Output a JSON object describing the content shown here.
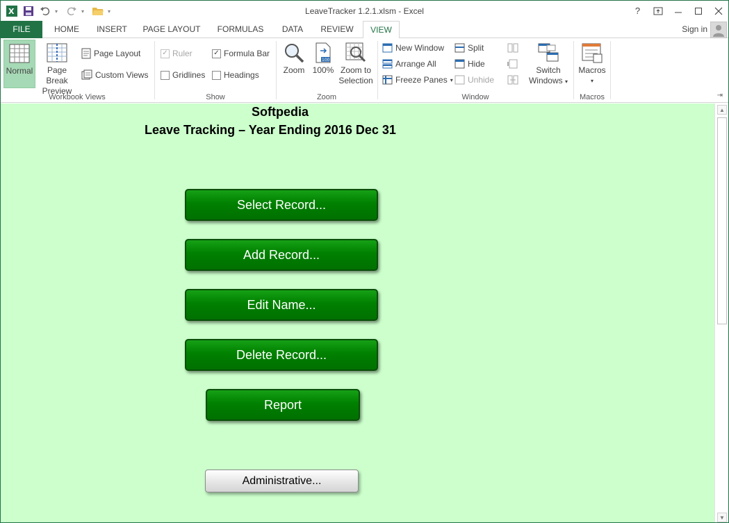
{
  "window": {
    "title": "LeaveTracker 1.2.1.xlsm - Excel",
    "help": "?",
    "controls": [
      "restore-ribbon",
      "minimize",
      "maximize",
      "close"
    ]
  },
  "tabs": [
    {
      "label": "FILE"
    },
    {
      "label": "HOME"
    },
    {
      "label": "INSERT"
    },
    {
      "label": "PAGE LAYOUT"
    },
    {
      "label": "FORMULAS"
    },
    {
      "label": "DATA"
    },
    {
      "label": "REVIEW"
    },
    {
      "label": "VIEW",
      "active": true
    }
  ],
  "account": {
    "signin": "Sign in"
  },
  "ribbon": {
    "workbook_views": {
      "label": "Workbook Views",
      "normal": "Normal",
      "page_break_1": "Page Break",
      "page_break_2": "Preview",
      "page_layout": "Page Layout",
      "custom_views": "Custom Views"
    },
    "show": {
      "label": "Show",
      "ruler": "Ruler",
      "gridlines": "Gridlines",
      "formula_bar": "Formula Bar",
      "headings": "Headings",
      "ruler_checked": true,
      "gridlines_checked": false,
      "formula_bar_checked": true,
      "headings_checked": false
    },
    "zoom": {
      "label": "Zoom",
      "zoom": "Zoom",
      "hundred": "100%",
      "zoom_sel_1": "Zoom to",
      "zoom_sel_2": "Selection"
    },
    "window": {
      "label": "Window",
      "new_window": "New Window",
      "arrange_all": "Arrange All",
      "freeze_panes": "Freeze Panes",
      "split": "Split",
      "hide": "Hide",
      "unhide": "Unhide",
      "switch_1": "Switch",
      "switch_2": "Windows"
    },
    "macros": {
      "label": "Macros",
      "macros": "Macros"
    }
  },
  "sheet": {
    "heading1": "Softpedia",
    "heading2": "Leave Tracking – Year Ending 2016 Dec 31",
    "buttons": {
      "select_record": "Select Record...",
      "add_record": "Add Record...",
      "edit_name": "Edit Name...",
      "delete_record": "Delete Record...",
      "report": "Report",
      "administrative": "Administrative..."
    },
    "background": "#ccffcc",
    "button_color": "#008000"
  },
  "colors": {
    "accent": "#217346"
  }
}
